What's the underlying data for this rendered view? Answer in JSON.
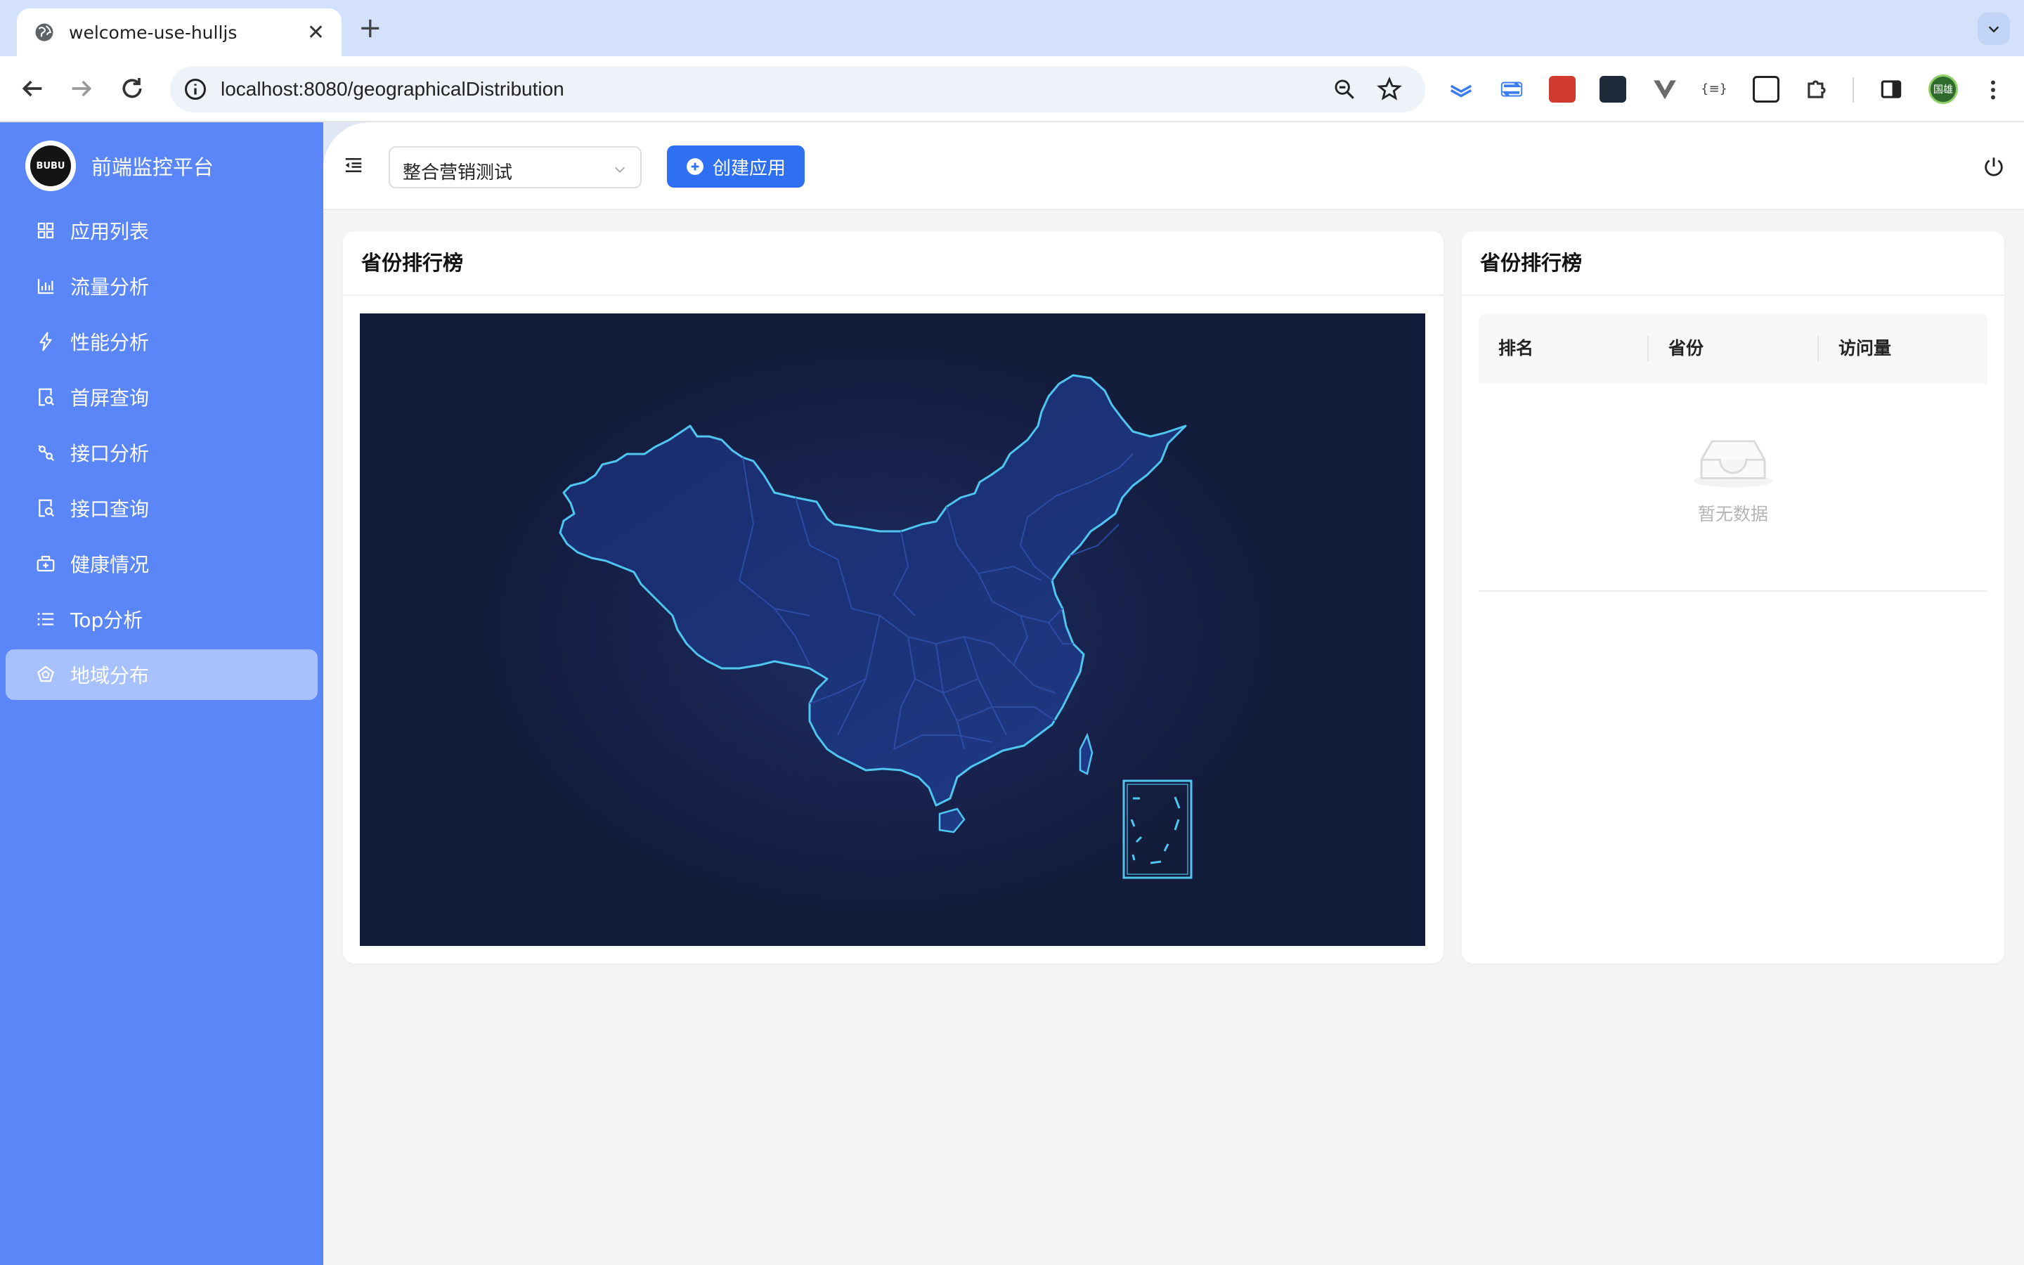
{
  "browser": {
    "tab_title": "welcome-use-hulljs",
    "url": "localhost:8080/geographicalDistribution",
    "profile_label": "国雄"
  },
  "sidebar": {
    "brand_logo_text": "BUBU",
    "brand_name": "前端监控平台",
    "items": [
      {
        "label": "应用列表",
        "icon": "grid-icon"
      },
      {
        "label": "流量分析",
        "icon": "bar-chart-icon"
      },
      {
        "label": "性能分析",
        "icon": "lightning-icon"
      },
      {
        "label": "首屏查询",
        "icon": "file-search-icon"
      },
      {
        "label": "接口分析",
        "icon": "api-icon"
      },
      {
        "label": "接口查询",
        "icon": "file-search-icon"
      },
      {
        "label": "健康情况",
        "icon": "medicine-box-icon"
      },
      {
        "label": "Top分析",
        "icon": "list-icon"
      },
      {
        "label": "地域分布",
        "icon": "radar-icon"
      }
    ],
    "active_index": 8
  },
  "header": {
    "app_select_value": "整合营销测试",
    "create_button_label": "创建应用"
  },
  "map_card": {
    "title": "省份排行榜"
  },
  "rank_card": {
    "title": "省份排行榜",
    "columns": [
      "排名",
      "省份",
      "访问量"
    ],
    "rows": [],
    "empty_text": "暂无数据"
  },
  "colors": {
    "sidebar_bg": "#5a86f8",
    "active_item_bg": "#a6c1fb",
    "primary_button": "#2f6ff1",
    "map_bg": "#141c3c",
    "map_fill": "#1d2e6e",
    "map_border": "#4fc6f0"
  }
}
